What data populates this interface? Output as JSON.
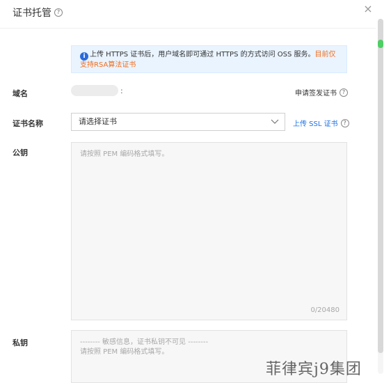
{
  "dialog": {
    "title": "证书托管",
    "help_glyph": "?",
    "close_glyph": "×"
  },
  "notice": {
    "icon_glyph": "i",
    "text": "上传 HTTPS 证书后，用户域名即可通过 HTTPS 的方式访问 OSS 服务。",
    "warning": "目前仅支持RSA算法证书"
  },
  "domain": {
    "label": "域名",
    "suffix": ":",
    "apply_link": "申请签发证书"
  },
  "cert_name": {
    "label": "证书名称",
    "placeholder": "请选择证书",
    "upload_link": "上传 SSL 证书"
  },
  "public_key": {
    "label": "公钥",
    "placeholder": "请按照 PEM 编码格式填写。",
    "counter": "0/20480"
  },
  "private_key": {
    "label": "私钥",
    "line1": "-------- 敏感信息，证书私钥不可见 --------",
    "line2": "请按照 PEM 编码格式填写。"
  },
  "watermark": "菲律宾j9集团",
  "colors": {
    "accent": "#1a73e8",
    "warning": "#f26d1d",
    "notice_bg": "#eaf4ff",
    "scroll_thumb": "#4ccf63"
  }
}
